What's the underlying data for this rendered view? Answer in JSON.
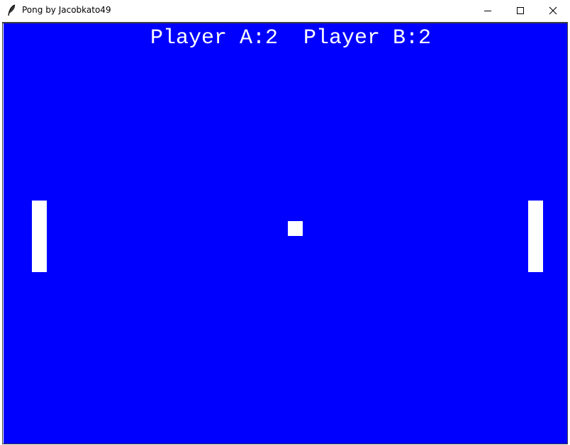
{
  "window": {
    "title": "Pong by Jacobkato49",
    "controls": {
      "minimize_icon": "minimize-icon",
      "maximize_icon": "maximize-icon",
      "close_icon": "close-icon"
    }
  },
  "game": {
    "score_text": "Player A:2  Player B:2",
    "score_a": 2,
    "score_b": 2,
    "colors": {
      "background": "#0000ff",
      "foreground": "#ffffff"
    }
  }
}
